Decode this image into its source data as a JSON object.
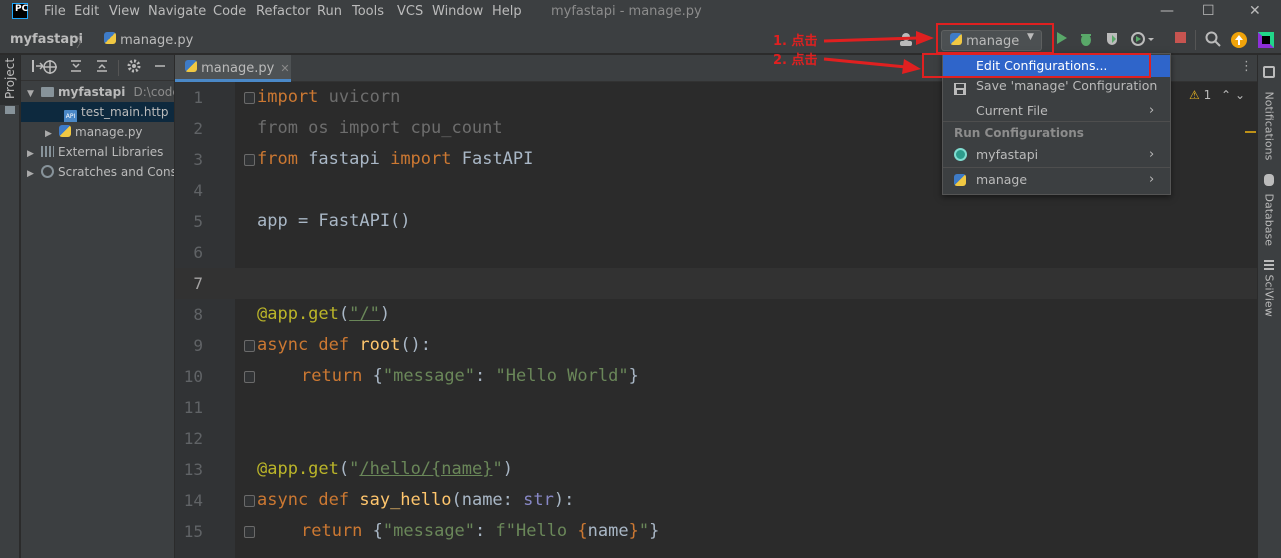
{
  "app": {
    "logo": "PC",
    "window_title": "myfastapi - manage.py"
  },
  "menu": [
    "File",
    "Edit",
    "View",
    "Navigate",
    "Code",
    "Refactor",
    "Run",
    "Tools",
    "VCS",
    "Window",
    "Help"
  ],
  "window_controls": {
    "minimize": "—",
    "maximize": "☐",
    "close": "✕"
  },
  "breadcrumb": {
    "project": "myfastapi",
    "file": "manage.py"
  },
  "run_config": {
    "selected": "manage"
  },
  "toolbar_icons": [
    "user-icon",
    "run-icon",
    "debug-icon",
    "coverage-icon",
    "profile-icon",
    "stop-icon",
    "search-icon",
    "update-icon",
    "jetbrains-icon"
  ],
  "left_toolwindow": {
    "project_label": "Project"
  },
  "project_tree": [
    {
      "label": "myfastapi",
      "hint": "D:\\code",
      "kind": "root"
    },
    {
      "label": "test_main.http",
      "kind": "file"
    },
    {
      "label": "manage.py",
      "kind": "file"
    },
    {
      "label": "External Libraries",
      "kind": "lib"
    },
    {
      "label": "Scratches and Cons",
      "kind": "scratch"
    }
  ],
  "editor": {
    "tab": "manage.py",
    "current_line": 7,
    "warning_count": "1",
    "line_numbers": [
      "1",
      "2",
      "3",
      "4",
      "5",
      "6",
      "7",
      "8",
      "9",
      "10",
      "11",
      "12",
      "13",
      "14",
      "15"
    ]
  },
  "code": {
    "l1_kw": "import",
    "l1_rest": " uvicorn",
    "l2": "from os import cpu_count",
    "l3_kw1": "from",
    "l3_mod": " fastapi ",
    "l3_kw2": "import",
    "l3_rest": " FastAPI",
    "l5": "app = FastAPI()",
    "l8_dec": "@app.get",
    "l8_p1": "(",
    "l8_str": "\"/\"",
    "l8_p2": ")",
    "l9_kw": "async def ",
    "l9_fn": "root",
    "l9_rest": "():",
    "l10_kw": "return ",
    "l10_b1": "{",
    "l10_s1": "\"message\"",
    "l10_c": ": ",
    "l10_s2": "\"Hello World\"",
    "l10_b2": "}",
    "l13_dec": "@app.get",
    "l13_p1": "(",
    "l13_q1": "\"",
    "l13_path": "/hello/{name}",
    "l13_q2": "\"",
    "l13_p2": ")",
    "l14_kw": "async def ",
    "l14_fn": "say_hello",
    "l14_p": "(name: ",
    "l14_type": "str",
    "l14_end": "):",
    "l15_kw": "return ",
    "l15_b1": "{",
    "l15_s1": "\"message\"",
    "l15_c": ": ",
    "l15_fs1": "f\"Hello ",
    "l15_br1": "{",
    "l15_var": "name",
    "l15_br2": "}",
    "l15_fs2": "\"",
    "l15_b2": "}"
  },
  "right_toolwindows": [
    "Notifications",
    "Database",
    "SciView"
  ],
  "popup": {
    "edit": "Edit Configurations...",
    "save": "Save 'manage' Configuration",
    "current_file": "Current File",
    "section": "Run Configurations",
    "item1": "myfastapi",
    "item2": "manage"
  },
  "annotations": {
    "step1": "1. 点击",
    "step2": "2. 点击"
  },
  "colors": {
    "accent": "#2f65ca",
    "annotation": "#e02020",
    "keyword": "#cc7832",
    "string": "#6a8759"
  }
}
